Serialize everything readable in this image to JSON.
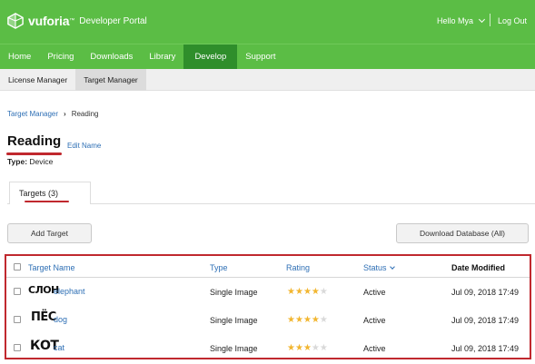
{
  "header": {
    "brand": "vuforia",
    "brand_tm": "™",
    "brand_sub": "Developer Portal",
    "greeting": "Hello Mya",
    "logout": "Log Out"
  },
  "nav": {
    "items": [
      "Home",
      "Pricing",
      "Downloads",
      "Library",
      "Develop",
      "Support"
    ],
    "active": "Develop"
  },
  "subnav": {
    "items": [
      "License Manager",
      "Target Manager"
    ],
    "active": "Target Manager"
  },
  "breadcrumb": {
    "parent": "Target Manager",
    "separator": "›",
    "current": "Reading"
  },
  "page": {
    "title": "Reading",
    "edit_label": "Edit Name",
    "type_label": "Type:",
    "type_value": "Device"
  },
  "tabs": [
    {
      "label": "Targets (3)"
    }
  ],
  "buttons": {
    "add": "Add Target",
    "download": "Download Database (All)"
  },
  "table": {
    "headers": {
      "name": "Target Name",
      "type": "Type",
      "rating": "Rating",
      "status": "Status",
      "date": "Date Modified"
    },
    "rows": [
      {
        "thumb": "СЛОН",
        "name": "elephant",
        "type": "Single Image",
        "rating": 4,
        "status": "Active",
        "date": "Jul 09, 2018 17:49"
      },
      {
        "thumb": "ПЁС",
        "name": "dog",
        "type": "Single Image",
        "rating": 4,
        "status": "Active",
        "date": "Jul 09, 2018 17:49"
      },
      {
        "thumb": "КОТ",
        "name": "cat",
        "type": "Single Image",
        "rating": 3,
        "status": "Active",
        "date": "Jul 09, 2018 17:49"
      }
    ],
    "max_rating": 5
  },
  "colors": {
    "brand_green": "#5bbd45",
    "active_nav": "#2f8e2b",
    "link_blue": "#2e6fb5",
    "annotation_red": "#c0282e",
    "star_filled": "#f2b630",
    "star_empty": "#d9d9d9"
  }
}
